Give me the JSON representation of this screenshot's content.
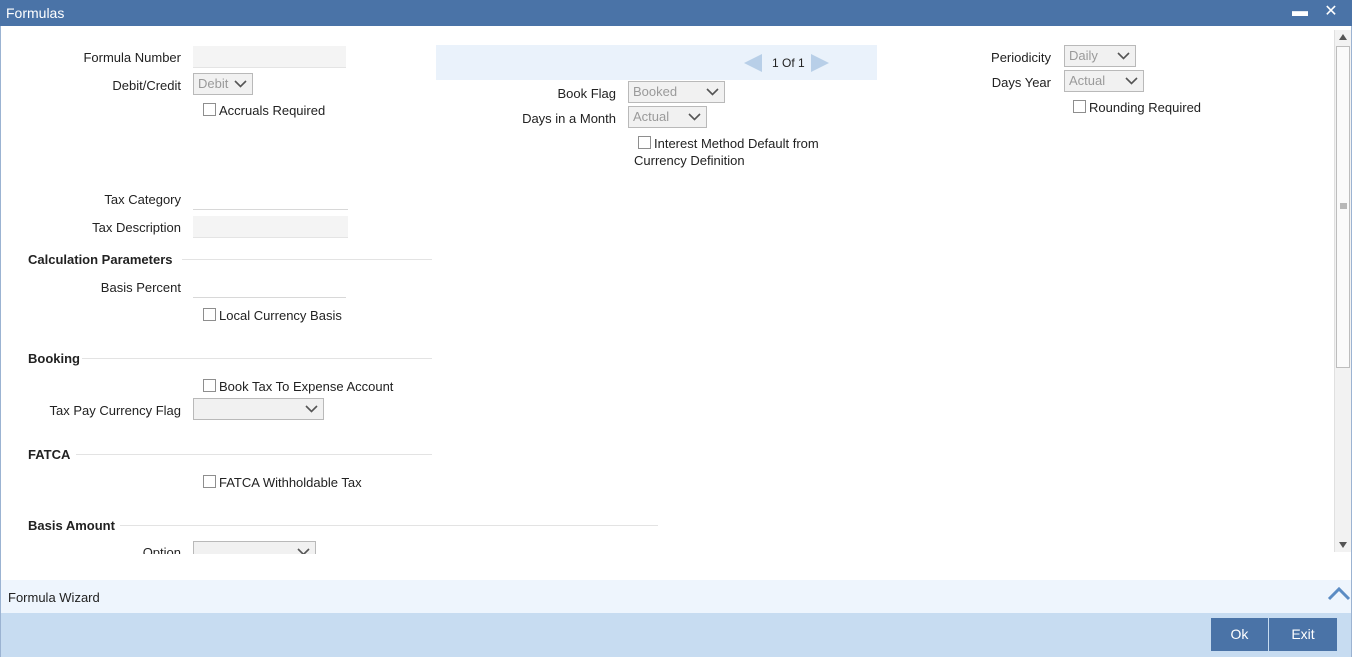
{
  "window": {
    "title": "Formulas",
    "minimize": "▬",
    "close": "✕"
  },
  "fields": {
    "formula_number": {
      "label": "Formula Number",
      "value": ""
    },
    "debit_credit": {
      "label": "Debit/Credit",
      "value": "Debit"
    },
    "accruals_required": {
      "label": "Accruals Required",
      "checked": false
    },
    "book_flag": {
      "label": "Book Flag",
      "value": "Booked"
    },
    "days_in_month": {
      "label": "Days in a Month",
      "value": "Actual"
    },
    "interest_method": {
      "label_line1": "Interest Method Default from",
      "label_line2": "Currency Definition",
      "checked": false
    },
    "periodicity": {
      "label": "Periodicity",
      "value": "Daily"
    },
    "days_year": {
      "label": "Days Year",
      "value": "Actual"
    },
    "rounding_required": {
      "label": "Rounding Required",
      "checked": false
    },
    "tax_category": {
      "label": "Tax Category",
      "value": ""
    },
    "tax_description": {
      "label": "Tax Description",
      "value": ""
    },
    "basis_percent": {
      "label": "Basis Percent",
      "value": ""
    },
    "local_currency_basis": {
      "label": "Local Currency Basis",
      "checked": false
    },
    "book_tax_expense": {
      "label": "Book Tax To Expense Account",
      "checked": false
    },
    "tax_pay_currency_flag": {
      "label": "Tax Pay Currency Flag",
      "value": ""
    },
    "fatca_withholdable": {
      "label": "FATCA Withholdable Tax",
      "checked": false
    },
    "option": {
      "label": "Option",
      "value": ""
    }
  },
  "sections": {
    "calculation": "Calculation Parameters",
    "booking": "Booking",
    "fatca": "FATCA",
    "basis_amount": "Basis Amount"
  },
  "pager": {
    "text": "1 Of 1"
  },
  "footer": {
    "wizard": "Formula Wizard",
    "ok": "Ok",
    "exit": "Exit"
  },
  "colors": {
    "titlebar": "#4a73a7",
    "footer": "#c7dcf1",
    "button": "#4a73a7",
    "pager_bg": "#eaf2fb"
  }
}
